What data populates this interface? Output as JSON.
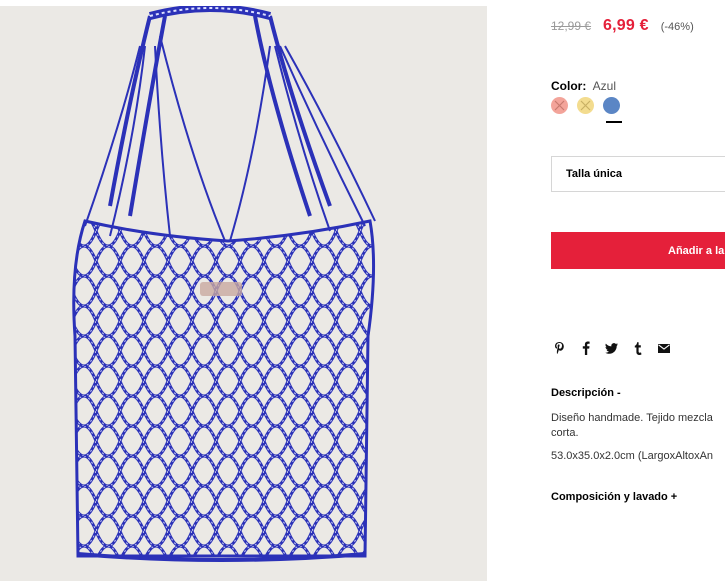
{
  "product": {
    "image_alt": "mesh-tote-bag-photo"
  },
  "price": {
    "old": "12,99 €",
    "new": "6,99 €",
    "discount": "(-46%)",
    "sale_color": "#e5203a"
  },
  "color": {
    "label": "Color:",
    "value": "Azul",
    "swatches": [
      {
        "name": "coral",
        "hex": "#f3a49a",
        "available": false
      },
      {
        "name": "yellow",
        "hex": "#f3dc8f",
        "available": false
      },
      {
        "name": "azul",
        "hex": "#5b86c5",
        "available": true,
        "selected": true
      }
    ]
  },
  "size": {
    "value": "Talla única"
  },
  "cart": {
    "add_label": "Añadir a la"
  },
  "share": {
    "icons": [
      "pinterest-icon",
      "facebook-icon",
      "twitter-icon",
      "tumblr-icon",
      "email-icon"
    ]
  },
  "description": {
    "title": "Descripción  -",
    "text": "Diseño handmade. Tejido mezcla corta.",
    "dimensions": "53.0x35.0x2.0cm (LargoxAltoxAn"
  },
  "composition": {
    "title": "Composición y lavado  +"
  }
}
